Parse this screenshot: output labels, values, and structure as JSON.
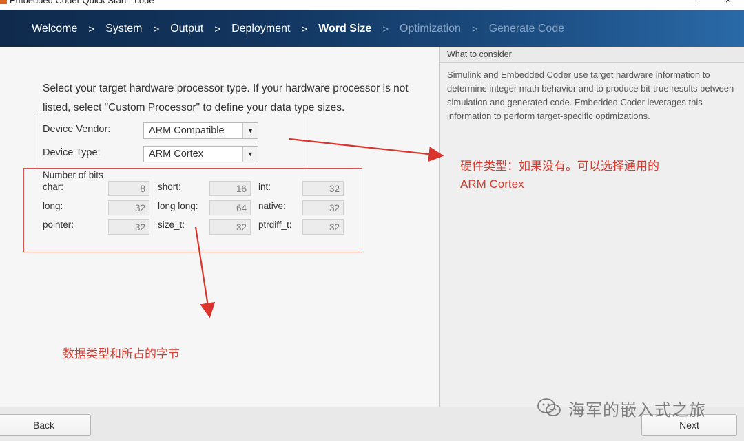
{
  "window": {
    "title": "Embedded Coder Quick Start - code"
  },
  "steps": [
    {
      "label": "Welcome",
      "state": "done"
    },
    {
      "label": "System",
      "state": "done"
    },
    {
      "label": "Output",
      "state": "done"
    },
    {
      "label": "Deployment",
      "state": "done"
    },
    {
      "label": "Word Size",
      "state": "current"
    },
    {
      "label": "Optimization",
      "state": "disabled"
    },
    {
      "label": "Generate Code",
      "state": "disabled"
    }
  ],
  "step_separator": ">",
  "main": {
    "intro": "Select your target hardware processor type. If your hardware processor is not listed, select \"Custom Processor\" to define your data type sizes.",
    "device_vendor": {
      "label": "Device Vendor:",
      "value": "ARM Compatible"
    },
    "device_type": {
      "label": "Device Type:",
      "value": "ARM Cortex"
    },
    "bits": {
      "heading": "Number of bits",
      "rows": [
        [
          {
            "label": "char:",
            "value": "8"
          },
          {
            "label": "short:",
            "value": "16"
          },
          {
            "label": "int:",
            "value": "32"
          }
        ],
        [
          {
            "label": "long:",
            "value": "32"
          },
          {
            "label": "long long:",
            "value": "64"
          },
          {
            "label": "native:",
            "value": "32"
          }
        ],
        [
          {
            "label": "pointer:",
            "value": "32"
          },
          {
            "label": "size_t:",
            "value": "32"
          },
          {
            "label": "ptrdiff_t:",
            "value": "32"
          }
        ]
      ]
    }
  },
  "help": {
    "header": "What to consider",
    "body": "Simulink and Embedded Coder use target hardware information to determine integer math behavior and to produce bit-true results between simulation and generated code. Embedded Coder leverages this information to perform target-specific optimizations."
  },
  "annotations": {
    "note_hardware_line1": "硬件类型：如果没有。可以选择通用的",
    "note_hardware_line2": "ARM Cortex",
    "note_datatypes": "数据类型和所占的字节",
    "color": "#d63b2f"
  },
  "footer": {
    "back_label": "Back",
    "next_label": "Next"
  },
  "watermark": {
    "text": "海军的嵌入式之旅",
    "icon": "wechat-icon"
  },
  "colors": {
    "banner_dark": "#0f2a4c",
    "banner_light": "#2a6aa8",
    "annotation_red": "#d9534f"
  }
}
